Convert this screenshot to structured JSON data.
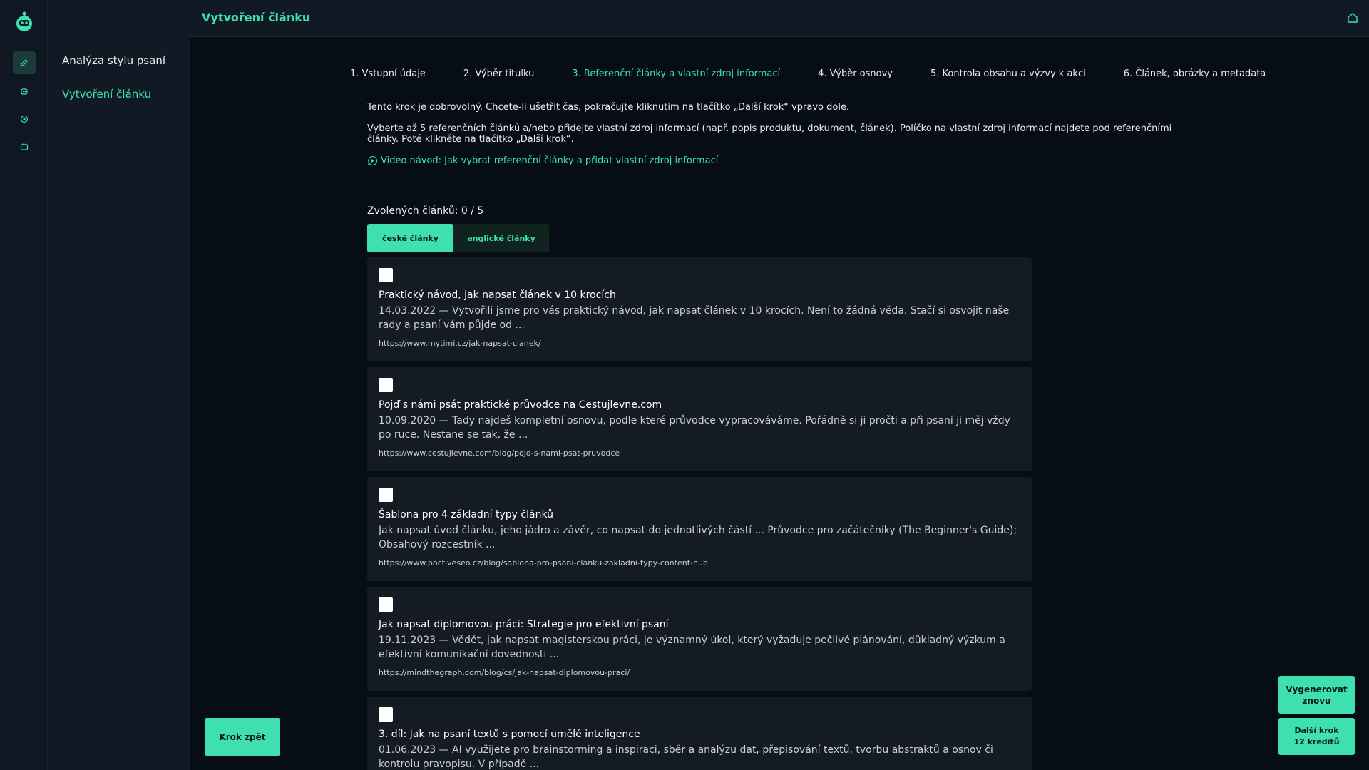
{
  "colors": {
    "accent": "#3ee0b0",
    "background": "#070d15",
    "card": "#151b23"
  },
  "sidebar": {
    "icons": [
      "pencil-icon",
      "robot-icon",
      "target-icon",
      "calendar-icon"
    ],
    "items": [
      {
        "label": "Analýza stylu psaní"
      },
      {
        "label": "Vytvoření článku"
      }
    ]
  },
  "header": {
    "title": "Vytvoření článku",
    "home_icon": "home-icon"
  },
  "steps": [
    {
      "label": "1. Vstupní údaje"
    },
    {
      "label": "2. Výběr titulku"
    },
    {
      "label": "3. Referenční články a vlastní zdroj informací"
    },
    {
      "label": "4. Výběr osnovy"
    },
    {
      "label": "5. Kontrola obsahu a výzvy k akci"
    },
    {
      "label": "6. Článek, obrázky a metadata"
    }
  ],
  "intro": {
    "line1": "Tento krok je dobrovolný. Chcete-li ušetřit čas, pokračujte kliknutím na tlačítko „Další krok“ vpravo dole.",
    "line2": "Vyberte až 5 referenčních článků a/nebo přidejte vlastní zdroj informací (např. popis produktu, dokument, článek). Políčko na vlastní zdroj informací najdete pod referenčními články. Poté klikněte na tlačítko „Další krok“.",
    "video_link": "Video návod: Jak vybrat referenční články a přidat vlastní zdroj informací"
  },
  "selection": {
    "count_label": "Zvolených článků: 0 / 5"
  },
  "tabs": [
    {
      "label": "české články"
    },
    {
      "label": "anglické články"
    }
  ],
  "articles": [
    {
      "title": "Praktický návod, jak napsat článek v 10 krocích",
      "desc": "14.03.2022 — Vytvořili jsme pro vás praktický návod, jak napsat článek v 10 krocích. Není to žádná věda. Stačí si osvojit naše rady a psaní vám půjde od ...",
      "url": "https://www.mytimi.cz/jak-napsat-clanek/"
    },
    {
      "title": "Pojď s námi psát praktické průvodce na Cestujlevne.com",
      "desc": "10.09.2020 — Tady najdeš kompletní osnovu, podle které průvodce vypracováváme. Pořádně si ji pročti a při psaní ji měj vždy po ruce. Nestane se tak, že ...",
      "url": "https://www.cestujlevne.com/blog/pojd-s-nami-psat-pruvodce"
    },
    {
      "title": "Šablona pro 4 základní typy článků",
      "desc": "Jak napsat úvod článku, jeho jádro a závěr, co napsat do jednotlivých částí ... Průvodce pro začátečníky (The Beginner's Guide); Obsahový rozcestník ...",
      "url": "https://www.poctiveseo.cz/blog/sablona-pro-psani-clanku-zakladni-typy-content-hub"
    },
    {
      "title": "Jak napsat diplomovou práci: Strategie pro efektivní psaní",
      "desc": "19.11.2023 — Vědět, jak napsat magisterskou práci, je významný úkol, který vyžaduje pečlivé plánování, důkladný výzkum a efektivní komunikační dovednosti ...",
      "url": "https://mindthegraph.com/blog/cs/jak-napsat-diplomovou-praci/"
    },
    {
      "title": "3. díl: Jak na psaní textů s pomocí umělé inteligence",
      "desc": "01.06.2023 — AI využijete pro brainstorming a inspiraci, sběr a analýzu dat, přepisování textů, tvorbu abstraktů a osnov či kontrolu pravopisu. V případě ...",
      "url": ""
    }
  ],
  "buttons": {
    "back": "Krok zpět",
    "regenerate_line1": "Vygenerovat",
    "regenerate_line2": "znovu",
    "next_line1": "Další krok",
    "next_line2": "12 kreditů"
  }
}
